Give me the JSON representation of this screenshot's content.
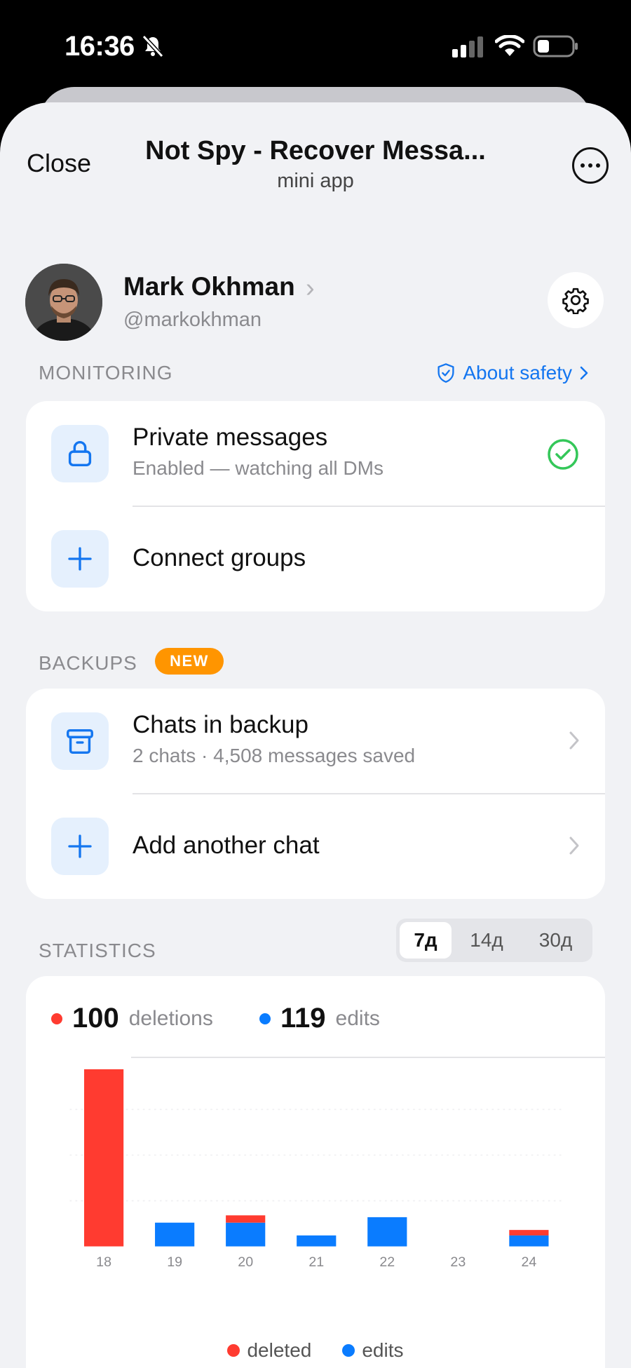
{
  "status_bar": {
    "time": "16:36"
  },
  "header": {
    "close_label": "Close",
    "title": "Not Spy - Recover Messa...",
    "subtitle": "mini app"
  },
  "profile": {
    "name": "Mark Okhman",
    "handle": "@markokhman"
  },
  "monitoring": {
    "title": "MONITORING",
    "about_label": "About safety",
    "items": [
      {
        "title": "Private messages",
        "subtitle": "Enabled — watching all DMs",
        "status_icon": "check-circle-icon"
      },
      {
        "title": "Connect groups"
      }
    ]
  },
  "backups": {
    "title": "BACKUPS",
    "badge": "NEW",
    "items": [
      {
        "title": "Chats in backup",
        "subtitle": "2 chats · 4,508 messages saved"
      },
      {
        "title": "Add another chat"
      }
    ]
  },
  "statistics": {
    "title": "STATISTICS",
    "periods": [
      "7д",
      "14д",
      "30д"
    ],
    "active_period": "7д",
    "deletions_count": "100",
    "deletions_label": "deletions",
    "edits_count": "119",
    "edits_label": "edits",
    "legend_deleted": "deleted",
    "legend_edits": "edits"
  },
  "colors": {
    "accent": "#1476f0",
    "deleted": "#ff3b30",
    "edits": "#0a7cff",
    "enabled": "#34c759",
    "badge": "#ff9500"
  },
  "chart_data": {
    "type": "bar",
    "stacked": true,
    "categories": [
      "18",
      "19",
      "20",
      "21",
      "22",
      "23",
      "24"
    ],
    "series": [
      {
        "name": "edits",
        "values": [
          0,
          13,
          13,
          6,
          16,
          0,
          6
        ]
      },
      {
        "name": "deleted",
        "values": [
          97,
          0,
          4,
          0,
          0,
          0,
          3
        ]
      }
    ],
    "ylim": [
      0,
      100
    ],
    "grid": true
  }
}
